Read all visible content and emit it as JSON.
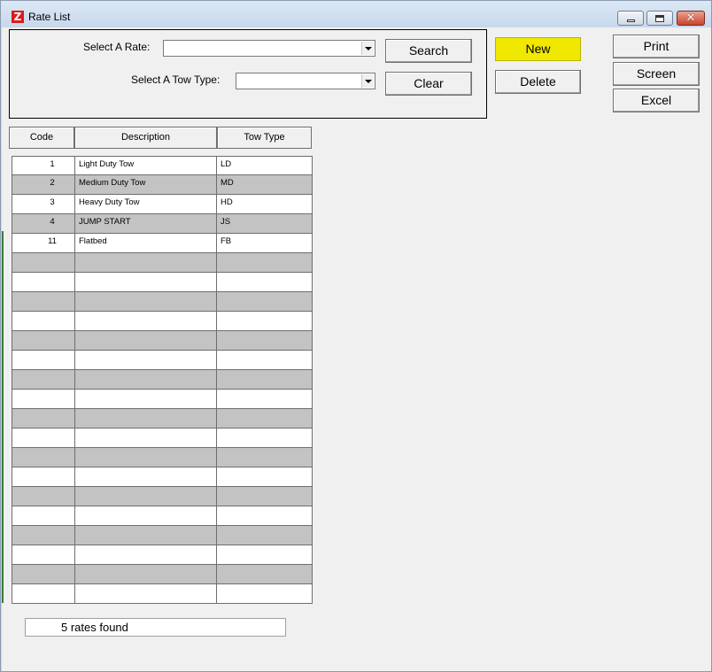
{
  "window": {
    "title": "Rate List",
    "app_icon_letter": "Z",
    "close_glyph": "✕"
  },
  "filters": {
    "rate_label": "Select A Rate:",
    "rate_value": "",
    "tow_type_label": "Select A Tow Type:",
    "tow_type_value": ""
  },
  "buttons": {
    "search": "Search",
    "clear": "Clear",
    "new": "New",
    "delete": "Delete",
    "print": "Print",
    "screen": "Screen",
    "excel": "Excel"
  },
  "colors": {
    "new_button": "#f0e800",
    "even_row": "#c3c3c3"
  },
  "grid": {
    "columns": [
      "Code",
      "Description",
      "Tow Type"
    ],
    "rows": [
      {
        "code": "1",
        "description": "Light Duty Tow",
        "tow_type": "LD"
      },
      {
        "code": "2",
        "description": "Medium Duty Tow",
        "tow_type": "MD"
      },
      {
        "code": "3",
        "description": "Heavy Duty Tow",
        "tow_type": "HD"
      },
      {
        "code": "4",
        "description": "JUMP START",
        "tow_type": "JS"
      },
      {
        "code": "11",
        "description": "Flatbed",
        "tow_type": "FB"
      },
      {
        "code": "",
        "description": "",
        "tow_type": ""
      },
      {
        "code": "",
        "description": "",
        "tow_type": ""
      },
      {
        "code": "",
        "description": "",
        "tow_type": ""
      },
      {
        "code": "",
        "description": "",
        "tow_type": ""
      },
      {
        "code": "",
        "description": "",
        "tow_type": ""
      },
      {
        "code": "",
        "description": "",
        "tow_type": ""
      },
      {
        "code": "",
        "description": "",
        "tow_type": ""
      },
      {
        "code": "",
        "description": "",
        "tow_type": ""
      },
      {
        "code": "",
        "description": "",
        "tow_type": ""
      },
      {
        "code": "",
        "description": "",
        "tow_type": ""
      },
      {
        "code": "",
        "description": "",
        "tow_type": ""
      },
      {
        "code": "",
        "description": "",
        "tow_type": ""
      },
      {
        "code": "",
        "description": "",
        "tow_type": ""
      },
      {
        "code": "",
        "description": "",
        "tow_type": ""
      },
      {
        "code": "",
        "description": "",
        "tow_type": ""
      },
      {
        "code": "",
        "description": "",
        "tow_type": ""
      },
      {
        "code": "",
        "description": "",
        "tow_type": ""
      },
      {
        "code": "",
        "description": "",
        "tow_type": ""
      }
    ]
  },
  "status": {
    "text": "5 rates found"
  }
}
